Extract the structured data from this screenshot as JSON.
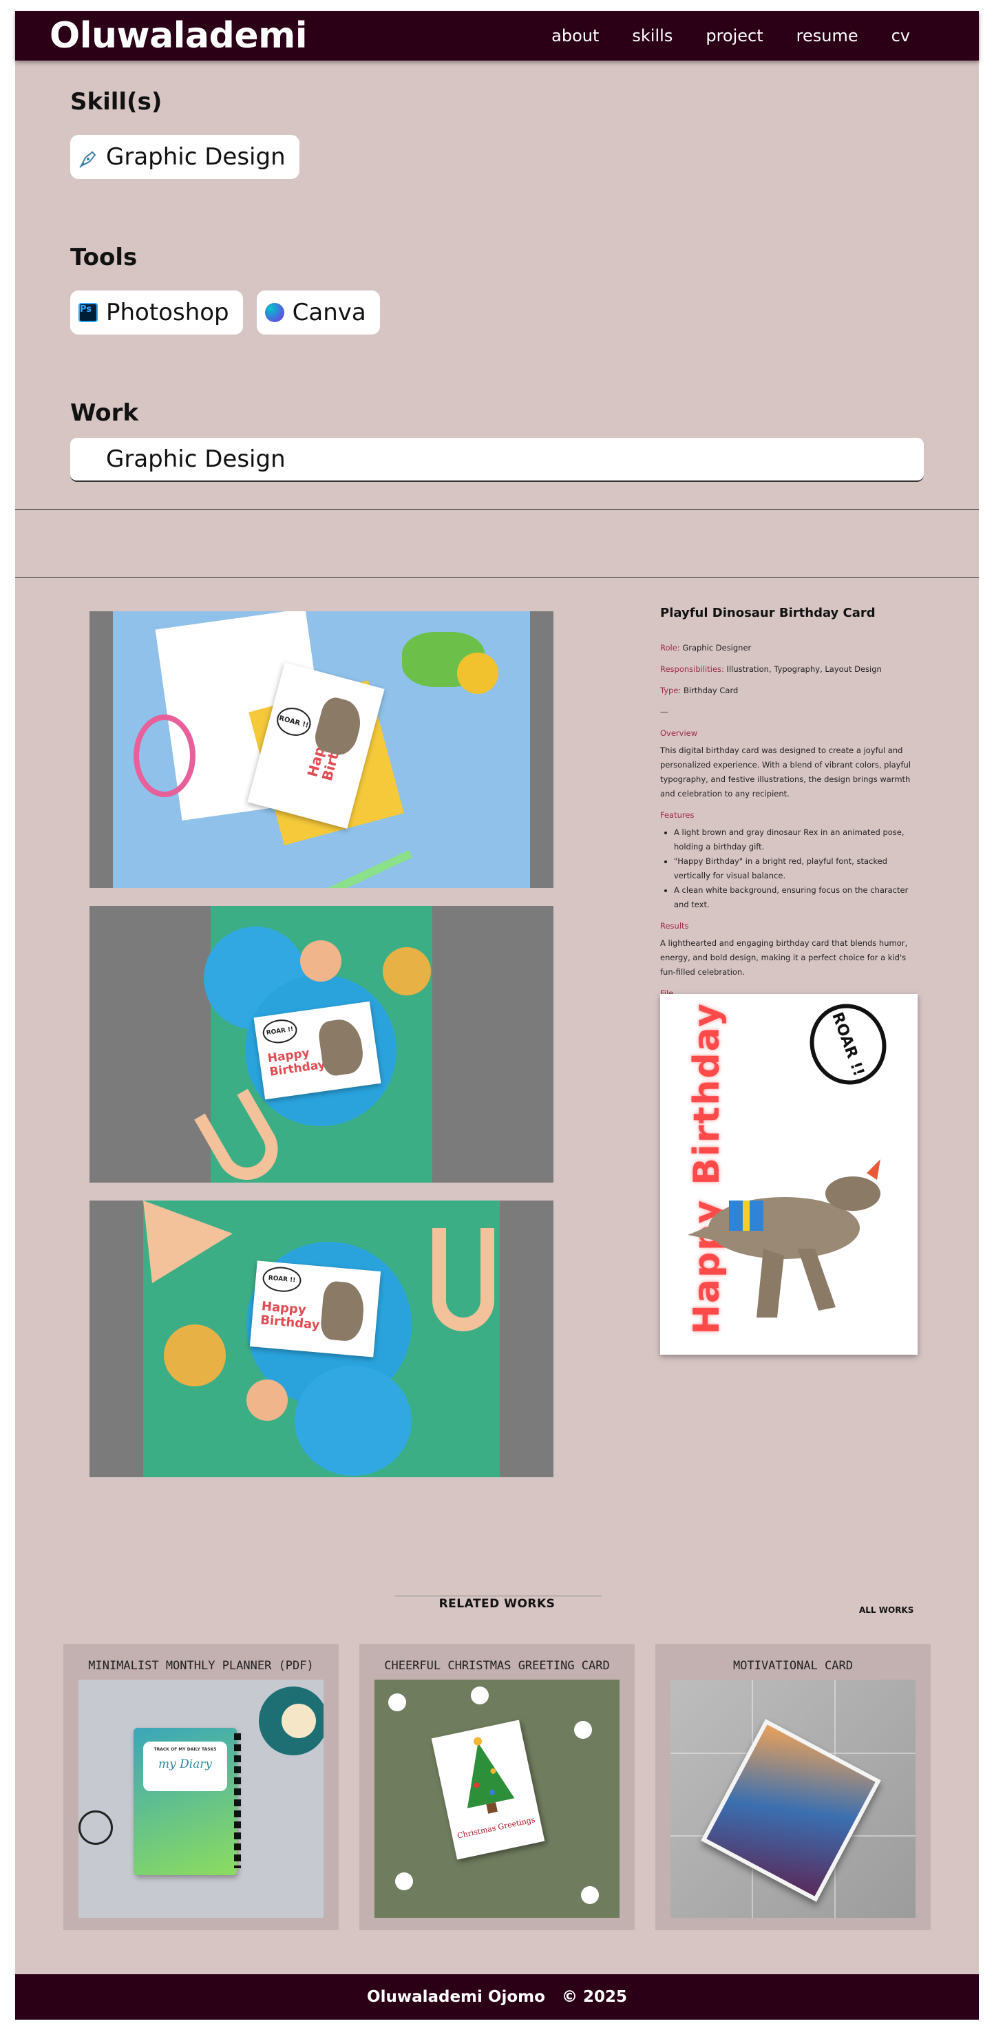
{
  "nav": {
    "logo": "Oluwalademi",
    "links": [
      "about",
      "skills",
      "project",
      "resume",
      "cv"
    ]
  },
  "skills": {
    "title": "Skill(s)",
    "items": [
      {
        "label": "Graphic Design",
        "icon": "pen-tool-icon"
      }
    ]
  },
  "tools": {
    "title": "Tools",
    "items": [
      {
        "label": "Photoshop",
        "icon": "photoshop-icon",
        "icon_text": "Ps"
      },
      {
        "label": "Canva",
        "icon": "canva-icon"
      }
    ]
  },
  "work": {
    "title": "Work",
    "tab": "Graphic Design"
  },
  "gallery": {
    "card_text_happy": "Happy",
    "card_text_birthday": "Birthday",
    "card_text_roar": "ROAR !!"
  },
  "details": {
    "title": "Playful Dinosaur Birthday Card",
    "role_label": "Role:",
    "role": "Graphic Designer",
    "resp_label": "Responsibilities:",
    "resp": "Illustration, Typography, Layout Design",
    "type_label": "Type:",
    "type": "Birthday Card",
    "divider": "—",
    "overview_label": "Overview",
    "overview": "This digital birthday card was designed to create a joyful and personalized experience. With a blend of vibrant colors, playful typography, and festive illustrations, the design brings warmth and celebration to any recipient.",
    "features_label": "Features",
    "features": [
      "A light brown and gray dinosaur Rex in an animated pose, holding a birthday gift.",
      "\"Happy Birthday\" in a bright red, playful font, stacked vertically for visual balance.",
      "A clean white background, ensuring focus on the character and text."
    ],
    "results_label": "Results",
    "results": "A lighthearted and engaging birthday card that blends humor, energy, and bold design, making it a perfect choice for a kid's fun-filled celebration.",
    "file_label": "File",
    "file_happy": "Happy",
    "file_birthday": "Birthday",
    "file_roar": "ROAR !!"
  },
  "related": {
    "title": "RELATED WORKS",
    "all_works": "ALL WORKS",
    "items": [
      {
        "title": "MINIMALIST MONTHLY PLANNER (PDF)",
        "book_top": "TRACK OF MY DAILY TASKS",
        "book_title": "my Diary"
      },
      {
        "title": "CHEERFUL CHRISTMAS GREETING CARD",
        "card_text": "Christmas Greetings"
      },
      {
        "title": "MOTIVATIONAL CARD"
      }
    ]
  },
  "footer": {
    "name": "Oluwalademi Ojomo",
    "copyright": "© 2025"
  }
}
